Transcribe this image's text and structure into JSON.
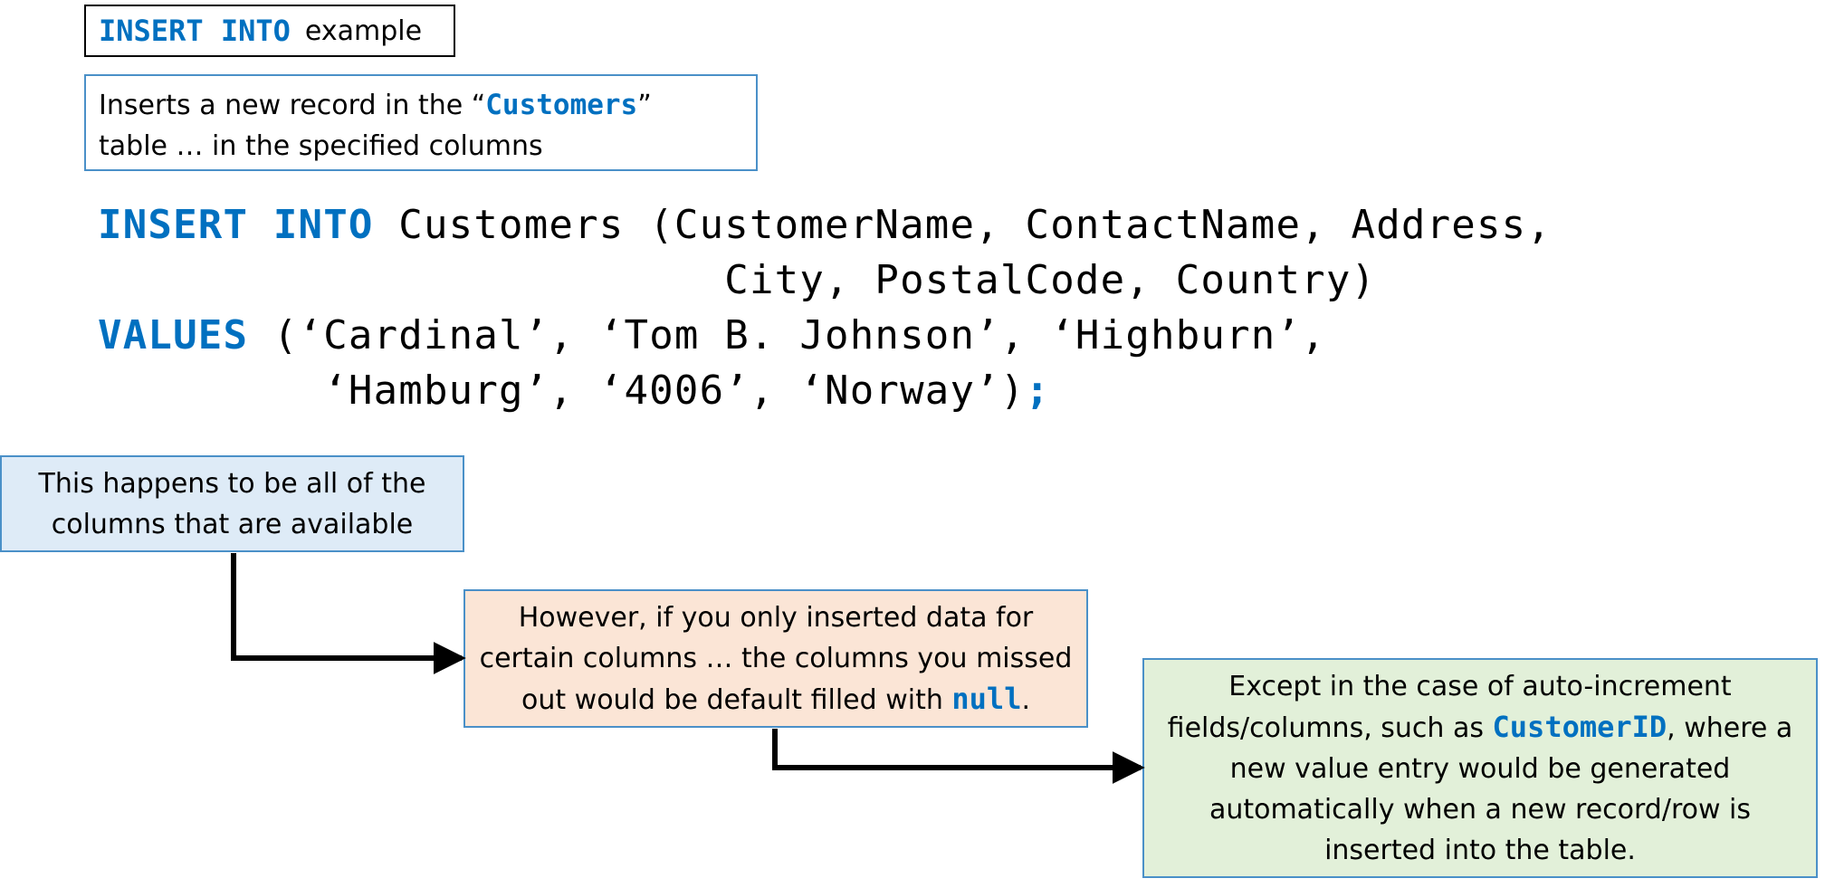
{
  "title": {
    "keyword": "INSERT INTO",
    "suffix": "example"
  },
  "description": {
    "before": "Inserts a new record in the “",
    "table_name": "Customers",
    "after": "”",
    "line2": "table … in the specified columns"
  },
  "sql": {
    "line1_keyword": "INSERT INTO",
    "line1_text": " Customers (CustomerName, ContactName, Address,",
    "line2_text": "                         City, PostalCode, Country)",
    "line3_keyword": "VALUES",
    "line3_text": " (‘Cardinal’, ‘Tom B. Johnson’, ‘Highburn’,",
    "line4_text": "         ‘Hamburg’, ‘4006’, ‘Norway’)",
    "terminator": ";"
  },
  "notes": {
    "columns": {
      "line1": "This happens to be all of the",
      "line2": "columns that are available"
    },
    "null": {
      "line1": "However, if you only inserted data for",
      "line2": "certain columns … the columns you missed",
      "line3_before": "out would be default filled with ",
      "line3_code": "null",
      "line3_after": "."
    },
    "autoinc": {
      "line1": "Except in the case of auto-increment",
      "line2_before": "fields/columns, such as ",
      "line2_code": "CustomerID",
      "line2_after": ", where a",
      "line3": "new value entry would be generated",
      "line4": "automatically when a new record/row is",
      "line5": "inserted into the table."
    }
  },
  "colors": {
    "keyword": "#0070C0",
    "box_border": "#4A90C8",
    "note_blue": "#DEEBF7",
    "note_orange": "#FBE5D6",
    "note_green": "#E2F0D9"
  }
}
